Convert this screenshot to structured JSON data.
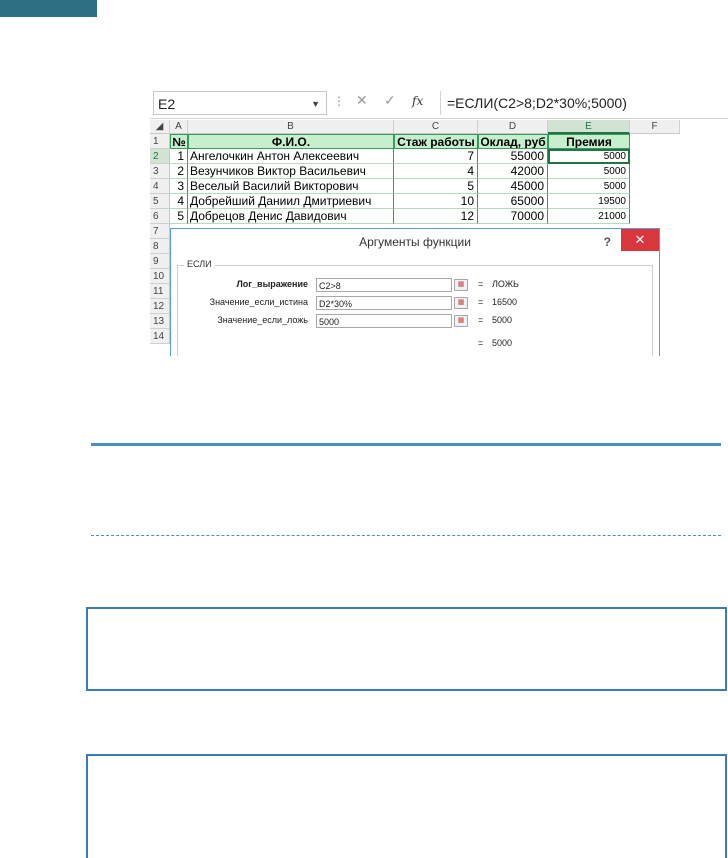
{
  "formula_bar": {
    "name_box": "E2",
    "formula": "=ЕСЛИ(C2>8;D2*30%;5000)",
    "fx_label": "fx"
  },
  "sheet": {
    "columns": [
      "A",
      "B",
      "C",
      "D",
      "E",
      "F"
    ],
    "rows": [
      "1",
      "2",
      "3",
      "4",
      "5",
      "6",
      "7",
      "8",
      "9",
      "10",
      "11",
      "12",
      "13",
      "14"
    ],
    "headers": {
      "a": "№",
      "b": "Ф.И.О.",
      "c": "Стаж работы",
      "d": "Оклад, руб",
      "e": "Премия"
    },
    "data": [
      {
        "n": "1",
        "name": "Ангелочкин Антон Алексеевич",
        "exp": "7",
        "salary": "55000",
        "bonus": "5000"
      },
      {
        "n": "2",
        "name": "Везунчиков Виктор Васильевич",
        "exp": "4",
        "salary": "42000",
        "bonus": "5000"
      },
      {
        "n": "3",
        "name": "Веселый Василий Викторович",
        "exp": "5",
        "salary": "45000",
        "bonus": "5000"
      },
      {
        "n": "4",
        "name": "Добрейший Даниил Дмитриевич",
        "exp": "10",
        "salary": "65000",
        "bonus": "19500"
      },
      {
        "n": "5",
        "name": "Добрецов Денис Давидович",
        "exp": "12",
        "salary": "70000",
        "bonus": "21000"
      }
    ]
  },
  "dialog": {
    "title": "Аргументы функции",
    "help": "?",
    "close": "✕",
    "function_name": "ЕСЛИ",
    "args": [
      {
        "label": "Лог_выражение",
        "value": "C2>8",
        "eq": "=",
        "result": "ЛОЖЬ"
      },
      {
        "label": "Значение_если_истина",
        "value": "D2*30%",
        "eq": "=",
        "result": "16500"
      },
      {
        "label": "Значение_если_ложь",
        "value": "5000",
        "eq": "=",
        "result": "5000"
      }
    ],
    "total": {
      "eq": "=",
      "result": "5000"
    }
  },
  "colors": {
    "accent": "#217346",
    "header_fill": "#c6efce",
    "rule": "#4a8ec8",
    "close": "#d9363e"
  }
}
